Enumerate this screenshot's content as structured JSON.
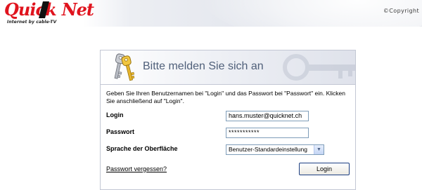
{
  "brand": {
    "logo_word1": "Quick",
    "logo_word2": "Net",
    "tagline": "Internet by cable-TV",
    "copyright": "©Copyright"
  },
  "login": {
    "title": "Bitte melden Sie sich an",
    "intro": "Geben Sie Ihren Benutzernamen bei \"Login\" und das Passwort bei \"Passwort\" ein. Klicken Sie anschließend auf \"Login\".",
    "login_label": "Login",
    "login_value": "hans.muster@quicknet.ch",
    "password_label": "Passwort",
    "password_value": "***********",
    "language_label": "Sprache der Oberfläche",
    "language_selected": "Benutzer-Standardeinstellung",
    "forgot_link": "Passwort vergessen?",
    "submit_label": "Login"
  },
  "colors": {
    "brand_red": "#e0141e",
    "title_blue": "#50607a",
    "button_border": "#1c3e82"
  },
  "icons": {
    "header_icon": "keys-icon",
    "select_arrow": "chevron-down-icon"
  }
}
